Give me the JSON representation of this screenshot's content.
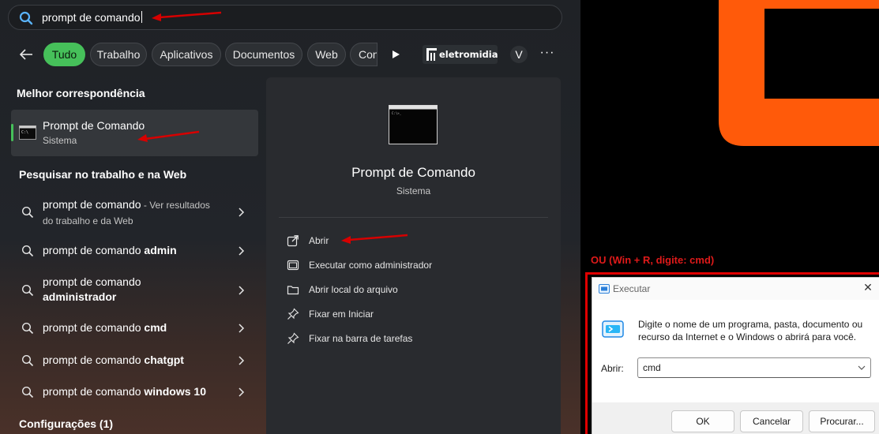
{
  "search": {
    "query": "prompt de comando"
  },
  "filters": {
    "chips": [
      {
        "label": "Tudo",
        "active": true
      },
      {
        "label": "Trabalho"
      },
      {
        "label": "Aplicativos"
      },
      {
        "label": "Documentos"
      },
      {
        "label": "Web"
      },
      {
        "label": "Con"
      }
    ],
    "brand_label": "eletromidia",
    "avatar_initial": "V",
    "more_label": "···"
  },
  "best_match": {
    "heading": "Melhor correspondência",
    "title": "Prompt de Comando",
    "subtitle": "Sistema"
  },
  "web_section": {
    "heading": "Pesquisar no trabalho e na Web",
    "results": [
      {
        "prefix": "prompt de comando",
        "suffix": " - Ver resultados",
        "line2": "do trabalho e da Web"
      },
      {
        "prefix": "prompt de comando ",
        "bold": "admin"
      },
      {
        "prefix": "prompt de comando",
        "line2_bold": "administrador"
      },
      {
        "prefix": "prompt de comando ",
        "bold": "cmd"
      },
      {
        "prefix": "prompt de comando ",
        "bold": "chatgpt"
      },
      {
        "prefix": "prompt de comando ",
        "bold": "windows 10"
      }
    ]
  },
  "settings_section": {
    "heading": "Configurações (1)"
  },
  "detail": {
    "title": "Prompt de Comando",
    "subtitle": "Sistema",
    "actions": [
      {
        "label": "Abrir",
        "icon": "open-external-icon"
      },
      {
        "label": "Executar como administrador",
        "icon": "shield-icon"
      },
      {
        "label": "Abrir local do arquivo",
        "icon": "folder-icon"
      },
      {
        "label": "Fixar em Iniciar",
        "icon": "pin-icon"
      },
      {
        "label": "Fixar na barra de tarefas",
        "icon": "pin-icon"
      }
    ]
  },
  "annotation": {
    "or_label": "OU  (Win + R, digite: cmd)"
  },
  "run_dialog": {
    "title": "Executar",
    "description": "Digite o nome de um programa, pasta, documento ou recurso da Internet e o Windows o abrirá para você.",
    "open_label": "Abrir:",
    "input_value": "cmd",
    "ok_label": "OK",
    "cancel_label": "Cancelar",
    "browse_label": "Procurar..."
  },
  "colors": {
    "accent_green": "#46c05a",
    "annotation_red": "#e01a1a",
    "brand_orange": "#ff5a0a"
  }
}
